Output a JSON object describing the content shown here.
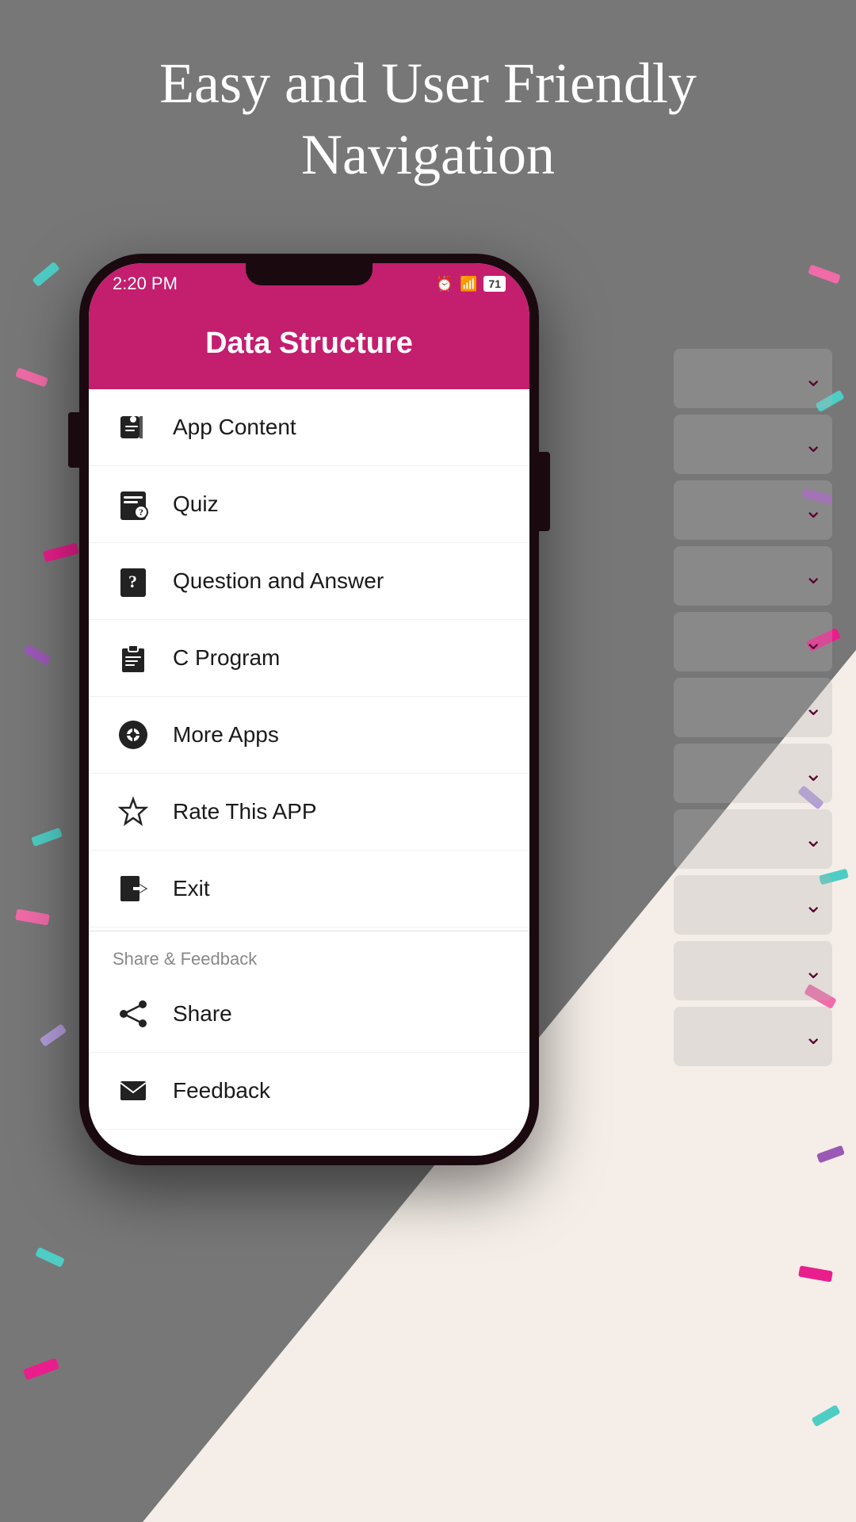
{
  "background": {
    "heading_line1": "Easy and User Friendly",
    "heading_line2": "Navigation"
  },
  "phone": {
    "status_bar": {
      "time": "2:20 PM",
      "battery": "71"
    },
    "app_header": {
      "title": "Data Structure"
    },
    "menu_items": [
      {
        "id": "app-content",
        "label": "App Content",
        "icon": "book"
      },
      {
        "id": "quiz",
        "label": "Quiz",
        "icon": "quiz"
      },
      {
        "id": "question-answer",
        "label": "Question and Answer",
        "icon": "qa"
      },
      {
        "id": "c-program",
        "label": "C Program",
        "icon": "clipboard"
      },
      {
        "id": "more-apps",
        "label": "More Apps",
        "icon": "grid"
      },
      {
        "id": "rate-app",
        "label": "Rate This APP",
        "icon": "star"
      },
      {
        "id": "exit",
        "label": "Exit",
        "icon": "exit"
      }
    ],
    "section_feedback": {
      "label": "Share & Feedback"
    },
    "feedback_items": [
      {
        "id": "share",
        "label": "Share",
        "icon": "share"
      },
      {
        "id": "feedback",
        "label": "Feedback",
        "icon": "envelope"
      }
    ]
  }
}
